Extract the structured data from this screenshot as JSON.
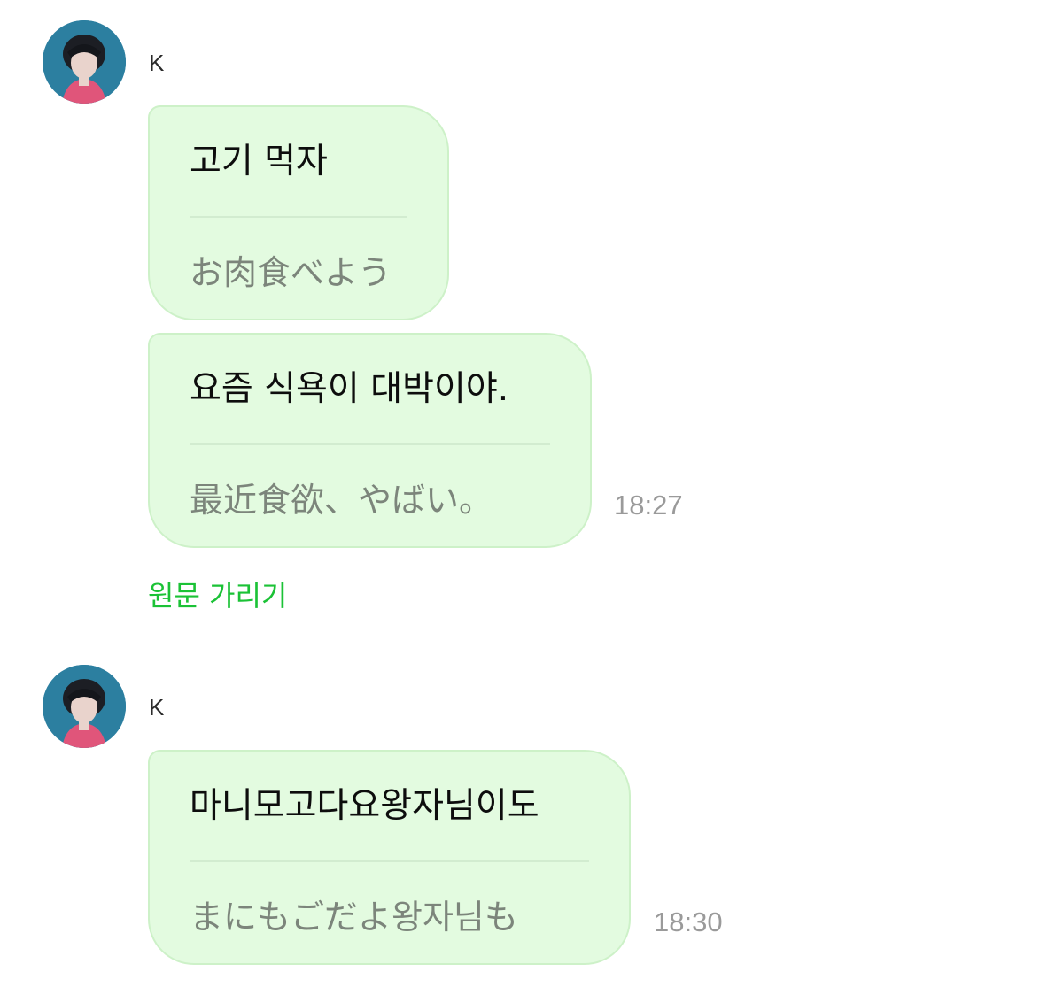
{
  "colors": {
    "bubble_bg": "#e3fbe0",
    "bubble_border": "#cdf1c8",
    "link_green": "#1bc236",
    "timestamp_gray": "#9a9a9a",
    "translation_gray": "#7c857b"
  },
  "groups": [
    {
      "sender": "K",
      "avatar_icon": "profile-photo",
      "messages": [
        {
          "original": "고기 먹자",
          "translation": "お肉食べよう",
          "time": ""
        },
        {
          "original": "요즘 식욕이 대박이야.",
          "translation": "最近食欲、やばい。",
          "time": "18:27"
        }
      ],
      "hide_original_label": "원문 가리기"
    },
    {
      "sender": "K",
      "avatar_icon": "profile-photo",
      "messages": [
        {
          "original": "마니모고다요왕자님이도",
          "translation": "まにもごだよ왕자님も",
          "time": "18:30"
        }
      ]
    }
  ]
}
